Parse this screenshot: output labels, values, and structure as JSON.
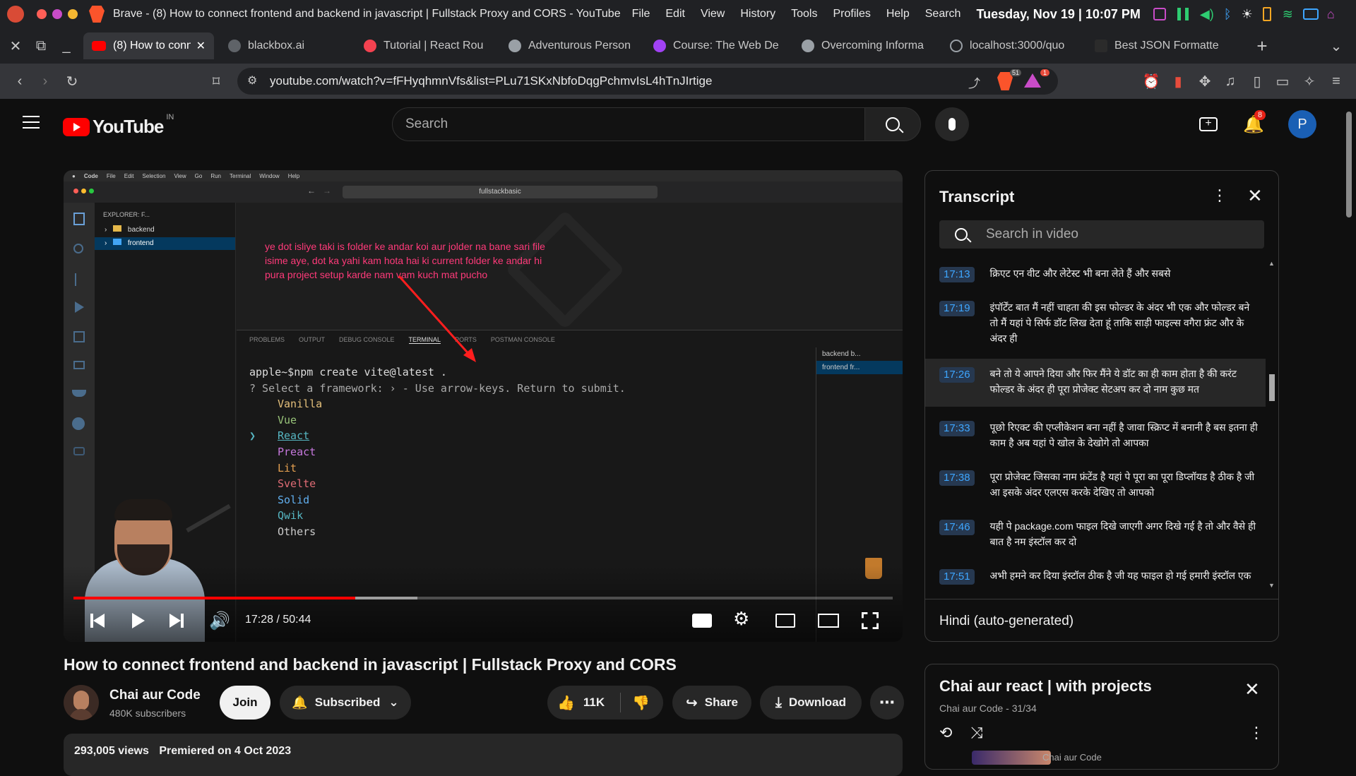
{
  "menubar": {
    "app_name": "Brave - (8) How to connect frontend and backend in javascript | Fullstack Proxy and CORS - YouTube",
    "menus": [
      "File",
      "Edit",
      "View",
      "History",
      "Tools",
      "Profiles",
      "Help",
      "Search"
    ],
    "datetime": "Tuesday, Nov 19 | 10:07 PM"
  },
  "tabs": [
    {
      "label": "(8) How to conn",
      "active": true,
      "icon_color": "#ff0000"
    },
    {
      "label": "blackbox.ai",
      "active": false,
      "icon_color": "#5f6368"
    },
    {
      "label": "Tutorial | React Rou",
      "active": false,
      "icon_color": "#f44250"
    },
    {
      "label": "Adventurous Person",
      "active": false,
      "icon_color": "#9aa0a6"
    },
    {
      "label": "Course: The Web De",
      "active": false,
      "icon_color": "#a142f4"
    },
    {
      "label": "Overcoming Informa",
      "active": false,
      "icon_color": "#9aa0a6"
    },
    {
      "label": "localhost:3000/quo",
      "active": false,
      "icon_color": "#9aa0a6"
    },
    {
      "label": "Best JSON Formatte",
      "active": false,
      "icon_color": "#2b2b2b"
    }
  ],
  "address": {
    "url": "youtube.com/watch?v=fFHyqhmnVfs&list=PLu71SKxNbfoDqgPchmvIsL4hTnJIrtige",
    "shield_count": "51",
    "notif_count": "1"
  },
  "yt": {
    "logo_text": "YouTube",
    "region": "IN",
    "search_placeholder": "Search",
    "notifications": "8",
    "avatar_letter": "P"
  },
  "video": {
    "title": "How to connect frontend and backend in javascript | Fullstack Proxy and CORS",
    "time": "17:28 / 50:44",
    "progress": 0.344,
    "buffered": 0.42,
    "channel": "Chai aur Code",
    "subscribers": "480K subscribers",
    "join": "Join",
    "subscribed": "Subscribed",
    "likes": "11K",
    "share": "Share",
    "download": "Download",
    "views": "293,005 views",
    "premiered": "Premiered on 4 Oct 2023"
  },
  "vscode": {
    "mac_menu": [
      "Code",
      "File",
      "Edit",
      "Selection",
      "View",
      "Go",
      "Run",
      "Terminal",
      "Window",
      "Help"
    ],
    "search": "fullstackbasic",
    "explorer": "EXPLORER: F...",
    "folders": [
      "backend",
      "frontend"
    ],
    "annotation": [
      "ye dot isliye taki is folder ke andar koi aur jolder na bane sari file",
      "isime aye, dot ka yahi kam hota hai ki current folder ke andar hi",
      "pura project setup karde nam vam kuch mat pucho"
    ],
    "panel_tabs": [
      "PROBLEMS",
      "OUTPUT",
      "DEBUG CONSOLE",
      "TERMINAL",
      "PORTS",
      "POSTMAN CONSOLE"
    ],
    "term_cmd": "apple~$npm create vite@latest .",
    "term_prompt": "? Select a framework: › - Use arrow-keys. Return to submit.",
    "frameworks": [
      {
        "name": "Vanilla",
        "color": "#e5c07b"
      },
      {
        "name": "Vue",
        "color": "#98c379"
      },
      {
        "name": "React",
        "color": "#56b6c2"
      },
      {
        "name": "Preact",
        "color": "#c678dd"
      },
      {
        "name": "Lit",
        "color": "#e5a050"
      },
      {
        "name": "Svelte",
        "color": "#e06c75"
      },
      {
        "name": "Solid",
        "color": "#61afef"
      },
      {
        "name": "Qwik",
        "color": "#56b6c2"
      },
      {
        "name": "Others",
        "color": "#cccccc"
      }
    ],
    "selected_marker": "❯",
    "term_list": [
      "backend b...",
      "frontend fr..."
    ]
  },
  "transcript": {
    "title": "Transcript",
    "search_placeholder": "Search in video",
    "language": "Hindi (auto-generated)",
    "segments": [
      {
        "t": "17:13",
        "text": "क्रिएट एन वीट और लेटेस्ट भी बना लेते हैं और सबसे"
      },
      {
        "t": "17:19",
        "text": "इंपॉर्टेंट बात मैं नहीं चाहता की इस फोल्डर के अंदर भी एक और फोल्डर बने तो मैं यहां पे सिर्फ डॉट लिख देता हूं ताकि साड़ी फाइल्स वगैरा फ्रंट और के अंदर ही"
      },
      {
        "t": "17:26",
        "text": "बने तो ये आपने दिया और फिर मैंने ये डॉट का ही काम होता है की करंट फोल्डर के अंदर ही पूरा प्रोजेक्ट सेटअप कर दो नाम कुछ मत"
      },
      {
        "t": "17:33",
        "text": "पूछो रिएक्ट की एप्लीकेशन बना नहीं है जावा स्क्रिप्ट में बनानी है बस इतना ही काम है अब यहां पे खोल के देखोगे तो आपका"
      },
      {
        "t": "17:38",
        "text": "पूरा प्रोजेक्ट जिसका नाम फ्रंटेंड है यहां पे पूरा का पूरा डिप्लॉयड है ठीक है जी आ इसके अंदर एलएस करके देखिए तो आपको"
      },
      {
        "t": "17:46",
        "text": "यही पे package.com फाइल दिखे जाएगी अगर दिखे गई है तो और वैसे ही बात है नम इंस्टॉल कर दो"
      },
      {
        "t": "17:51",
        "text": "अभी हमने कर दिया इंस्टॉल ठीक है जी यह फाइल हो गई हमारी इंस्टॉल एक"
      }
    ]
  },
  "playlist": {
    "title": "Chai aur react | with projects",
    "sub": "Chai aur Code - 31/34",
    "next_channel": "Chai aur Code"
  }
}
